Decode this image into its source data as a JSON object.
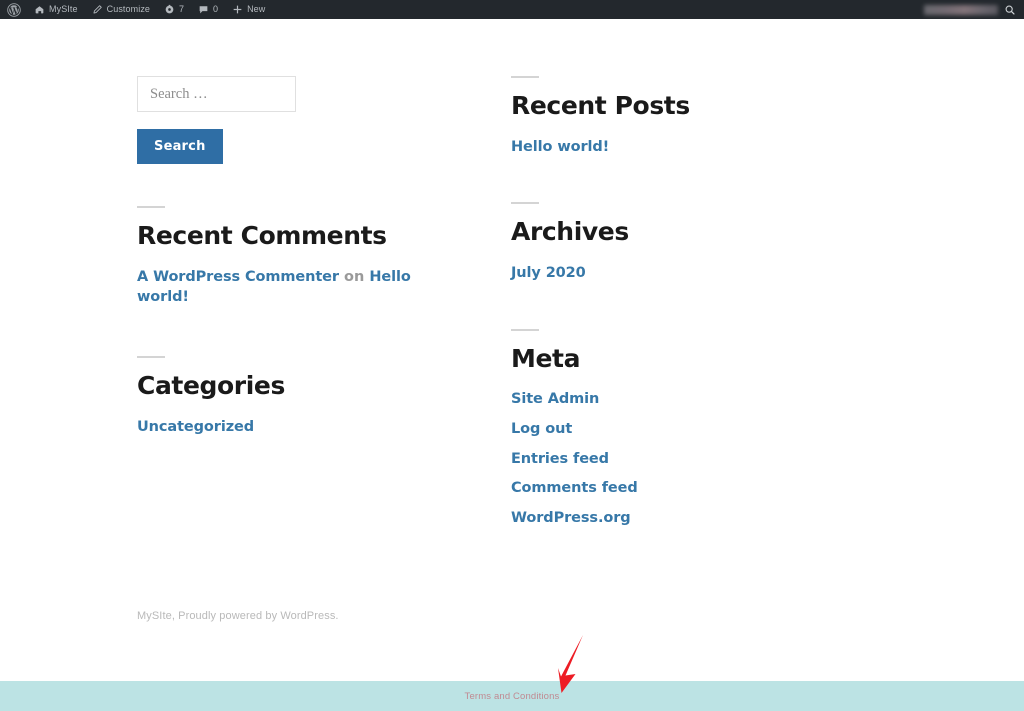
{
  "adminbar": {
    "wp_logo_icon": "wordpress-logo-icon",
    "site_name": "MySIte",
    "site_icon": "home-icon",
    "customize_label": "Customize",
    "customize_icon": "pencil-icon",
    "updates_icon": "updates-icon",
    "updates_count": "7",
    "comments_icon": "comment-bubble-icon",
    "comments_count": "0",
    "new_icon": "plus-icon",
    "new_label": "New",
    "search_icon": "search-icon",
    "account_redacted": ""
  },
  "search_widget": {
    "placeholder": "Search …",
    "value": "",
    "submit_label": "Search"
  },
  "widgets": {
    "recent_comments": {
      "title": "Recent Comments",
      "items": [
        {
          "author": "A WordPress Commenter",
          "separator": " on ",
          "post": "Hello world!"
        }
      ]
    },
    "categories": {
      "title": "Categories",
      "items": [
        "Uncategorized"
      ]
    },
    "recent_posts": {
      "title": "Recent Posts",
      "items": [
        "Hello world!"
      ]
    },
    "archives": {
      "title": "Archives",
      "items": [
        "July 2020"
      ]
    },
    "meta": {
      "title": "Meta",
      "items": [
        "Site Admin",
        "Log out",
        "Entries feed",
        "Comments feed",
        "WordPress.org"
      ]
    }
  },
  "footer": {
    "credit": "MySIte, Proudly powered by WordPress."
  },
  "terms_bar": {
    "link_label": "Terms and Conditions"
  },
  "annotation": {
    "arrow": "red-arrow-icon"
  },
  "colors": {
    "adminbar_bg": "#23282d",
    "link_blue": "#3778a8",
    "button_blue": "#2f6ea5",
    "terms_bar_bg": "#bce3e4",
    "terms_link": "#c08a92",
    "annotation_red": "#ed1c24",
    "heading": "#1a1a1a"
  }
}
